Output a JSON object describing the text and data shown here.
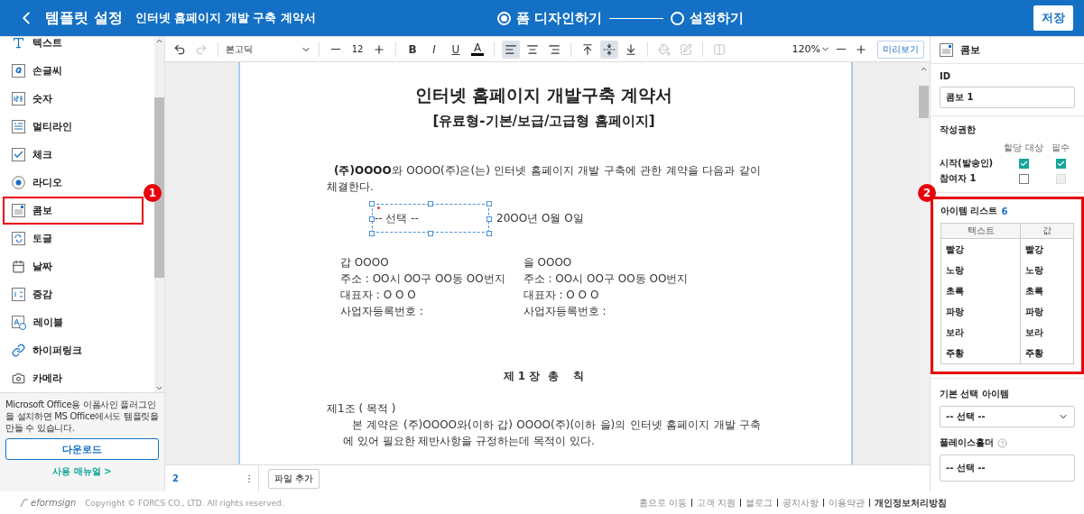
{
  "header": {
    "title": "템플릿 설정",
    "document": "인터넷 홈페이지 개발 구축 계약서",
    "steps": [
      {
        "label": "폼 디자인하기",
        "selected": true
      },
      {
        "label": "설정하기",
        "selected": false
      }
    ],
    "save": "저장"
  },
  "sidebar": {
    "items": [
      {
        "label": "텍스트",
        "highlighted": false
      },
      {
        "label": "손글씨",
        "highlighted": false
      },
      {
        "label": "숫자",
        "highlighted": false
      },
      {
        "label": "멀티라인",
        "highlighted": false
      },
      {
        "label": "체크",
        "highlighted": false
      },
      {
        "label": "라디오",
        "highlighted": false
      },
      {
        "label": "콤보",
        "highlighted": true,
        "callout": "1"
      },
      {
        "label": "토글",
        "highlighted": false
      },
      {
        "label": "날짜",
        "highlighted": false
      },
      {
        "label": "증감",
        "highlighted": false
      },
      {
        "label": "레이블",
        "highlighted": false
      },
      {
        "label": "하이퍼링크",
        "highlighted": false
      },
      {
        "label": "카메라",
        "highlighted": false
      }
    ],
    "note": "Microsoft Office용 이폼사인 플러그인을 설치하면 MS Office에서도 템플릿을 만들 수 있습니다.",
    "download": "다운로드",
    "manual": "사용 매뉴얼 >"
  },
  "toolbar": {
    "history": [
      {
        "disabled": false
      },
      {
        "disabled": true
      }
    ],
    "font": "본고딕",
    "size": "12",
    "format": [
      "B",
      "I",
      "U",
      "A"
    ],
    "alignment": [
      {
        "selected": true
      },
      {
        "selected": false
      },
      {
        "selected": false
      }
    ],
    "vertical_alignment": [
      {
        "selected": false
      },
      {
        "selected": true
      },
      {
        "selected": false
      }
    ],
    "color_tools": [
      {
        "disabled": true
      },
      {
        "disabled": true
      },
      {
        "disabled": true
      }
    ],
    "zoom": "120%",
    "preview": "미리보기"
  },
  "document": {
    "title": "인터넷 홈페이지 개발구축 계약서",
    "subtitle": "[유료형-기본/보급/고급형 홈페이지]",
    "intro": "**(주)OOOO**와 OOOO(주)은(는) 인터넷 홈페이지 개발 구축에 관한 계약을 다음과 같이 체결한다.",
    "combo_field": {
      "value": "-- 선택 --",
      "required": true
    },
    "date": "20OO년 O월 O일",
    "parties": [
      [
        "갑 OOOO",
        "을 OOOO"
      ],
      [
        "주소 : OO시 OO구 OO동 OO번지",
        "주소 : OO시 OO구 OO동 OO번지"
      ],
      [
        "대표자 : O O O",
        "대표자 : O O O"
      ],
      [
        "사업자등록번호 :",
        "사업자등록번호 :"
      ]
    ],
    "chapter": "제 1 장  총    칙",
    "article": "제1조 ( 목적 )",
    "article_text": "본 계약은 (주)OOOO와(이하 갑) OOOO(주)(이하 을)의 인터넷 홈페이지 개발 구축에 있어 필요한 제반사항을 규정하는데 목적이 있다."
  },
  "pages": {
    "current": "2",
    "add_file": "파일 추가"
  },
  "properties": {
    "title": "콤보",
    "id_label": "ID",
    "id_value": "콤보 1",
    "permission_title": "작성권한",
    "permission_columns": [
      "할당 대상",
      "필수"
    ],
    "permissions": [
      {
        "name": "시작(발송인)",
        "assigned": {
          "checked": true,
          "disabled": false
        },
        "required": {
          "checked": true,
          "disabled": false
        }
      },
      {
        "name": "참여자 1",
        "assigned": {
          "checked": false,
          "disabled": false
        },
        "required": {
          "checked": false,
          "disabled": true
        }
      }
    ],
    "item_list": {
      "title": "아이템 리스트",
      "count": "6",
      "highlighted": true,
      "callout": "2",
      "columns": [
        "텍스트",
        "값"
      ],
      "rows": [
        [
          "빨강",
          "빨강"
        ],
        [
          "노랑",
          "노랑"
        ],
        [
          "초록",
          "초록"
        ],
        [
          "파랑",
          "파랑"
        ],
        [
          "보라",
          "보라"
        ],
        [
          "주황",
          "주황"
        ]
      ]
    },
    "default_label": "기본 선택 아이템",
    "default_value": "-- 선택 --",
    "placeholder_label": "플레이스홀더",
    "placeholder_value": "-- 선택 --"
  },
  "footer": {
    "logo": "eformsign",
    "copyright": "Copyright © FORCS CO., LTD. All rights reserved.",
    "links": [
      {
        "label": "홈으로 이동",
        "bold": false
      },
      {
        "label": "고객 지원",
        "bold": false
      },
      {
        "label": "블로그",
        "bold": false
      },
      {
        "label": "공지사항",
        "bold": false
      },
      {
        "label": "이용약관",
        "bold": false
      },
      {
        "label": "개인정보처리방침",
        "bold": true
      }
    ]
  }
}
